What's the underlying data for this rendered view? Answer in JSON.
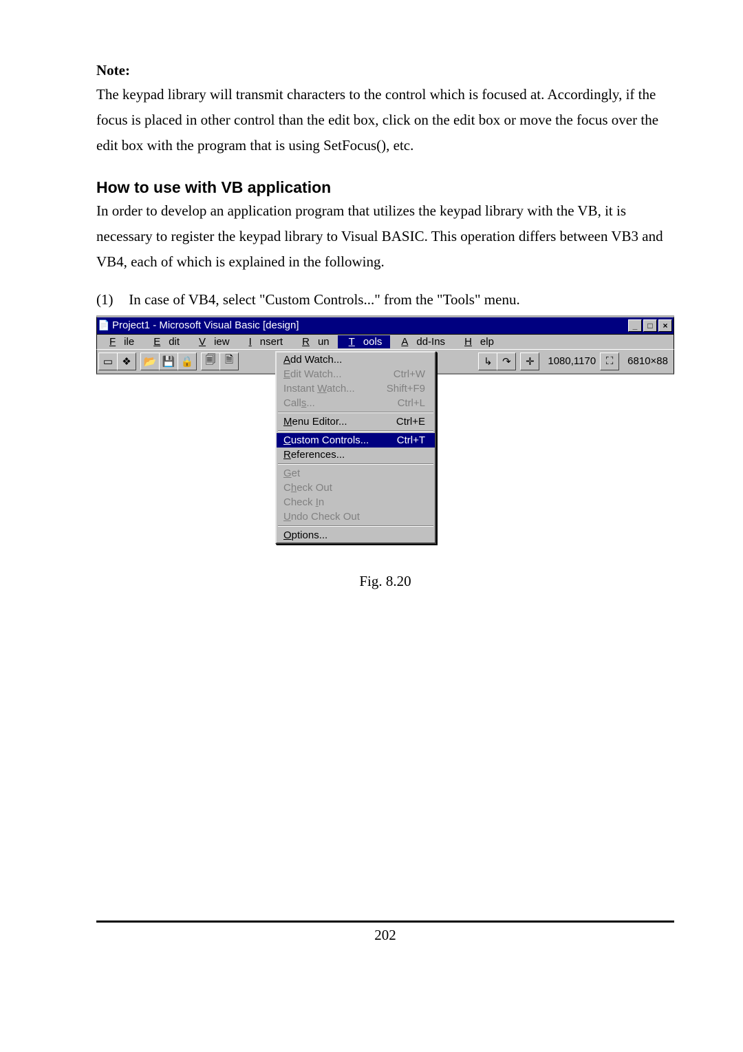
{
  "note": {
    "heading": "Note:",
    "body": "The keypad library will transmit characters to the control which is focused at. Accordingly, if the focus is placed in other control than the edit box, click on the edit box or move the focus over the edit box with the program that is using SetFocus(), etc."
  },
  "section_title": "How to use with VB application",
  "section_body": "In order to develop an application program that utilizes the keypad library with the VB, it is necessary to register the keypad library to Visual BASIC. This operation differs between VB3 and VB4, each of which is explained in the following.",
  "list_item": {
    "index": "(1)",
    "text": "In case of VB4, select \"Custom Controls...\" from the \"Tools\" menu."
  },
  "vb": {
    "title": "Project1 - Microsoft Visual Basic [design]",
    "menubar": {
      "file": "File",
      "edit": "Edit",
      "view": "View",
      "insert": "Insert",
      "run": "Run",
      "tools": "Tools",
      "addins": "Add-Ins",
      "help": "Help"
    },
    "status": {
      "pos": "1080,1170",
      "size": "6810×88"
    },
    "menu": {
      "add_watch": "Add Watch...",
      "edit_watch": "Edit Watch...",
      "edit_watch_sc": "Ctrl+W",
      "instant_watch": "Instant Watch...",
      "instant_watch_sc": "Shift+F9",
      "calls": "Calls...",
      "calls_sc": "Ctrl+L",
      "menu_editor": "Menu Editor...",
      "menu_editor_sc": "Ctrl+E",
      "custom_controls": "Custom Controls...",
      "custom_controls_sc": "Ctrl+T",
      "references": "References...",
      "get": "Get",
      "check_out": "Check Out",
      "check_in": "Check In",
      "undo_check_out": "Undo Check Out",
      "options": "Options..."
    }
  },
  "caption": "Fig. 8.20",
  "page_number": "202"
}
